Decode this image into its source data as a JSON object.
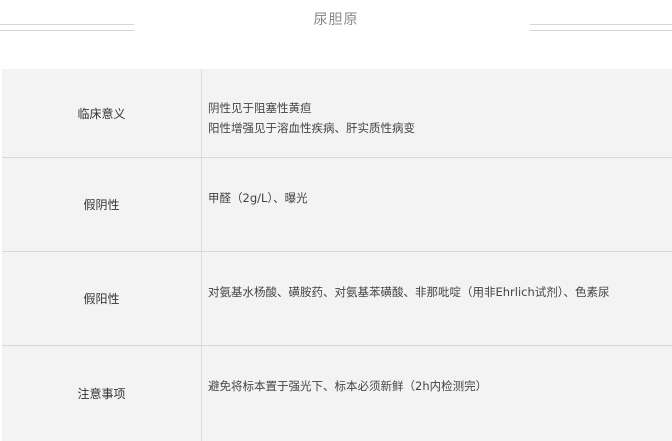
{
  "header": {
    "title": "尿胆原"
  },
  "rows": [
    {
      "label": "临床意义",
      "lines": [
        "阴性见于阻塞性黄疸",
        "阳性增强见于溶血性疾病、肝实质性病变"
      ]
    },
    {
      "label": "假阴性",
      "lines": [
        "甲醛（2g/L）、曝光"
      ]
    },
    {
      "label": "假阳性",
      "lines": [
        "对氨基水杨酸、磺胺药、对氨基苯磺酸、非那吡啶（用非Ehrlich试剂）、色素尿"
      ]
    },
    {
      "label": "注意事项",
      "lines": [
        "避免将标本置于强光下、标本必须新鲜（2h内检测完）"
      ]
    }
  ]
}
